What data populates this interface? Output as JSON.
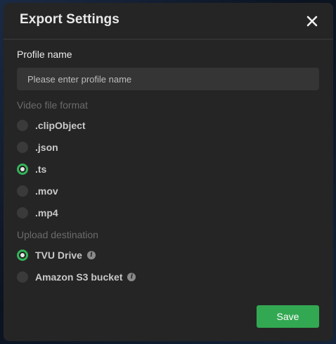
{
  "dialog": {
    "title": "Export Settings",
    "close_icon": "close-icon"
  },
  "profile": {
    "label": "Profile name",
    "placeholder": "Please enter profile name",
    "value": ""
  },
  "video_format": {
    "label": "Video file format",
    "options": [
      {
        "label": ".clipObject",
        "checked": false
      },
      {
        "label": ".json",
        "checked": false
      },
      {
        "label": ".ts",
        "checked": true
      },
      {
        "label": ".mov",
        "checked": false
      },
      {
        "label": ".mp4",
        "checked": false
      }
    ]
  },
  "upload": {
    "label": "Upload destination",
    "options": [
      {
        "label": "TVU Drive",
        "checked": true,
        "icon": "info-icon"
      },
      {
        "label": "Amazon S3 bucket",
        "checked": false,
        "icon": "info-icon"
      }
    ]
  },
  "save_label": "Save",
  "colors": {
    "accent": "#33a853",
    "dialog_bg": "#252525",
    "input_bg": "#353535"
  }
}
